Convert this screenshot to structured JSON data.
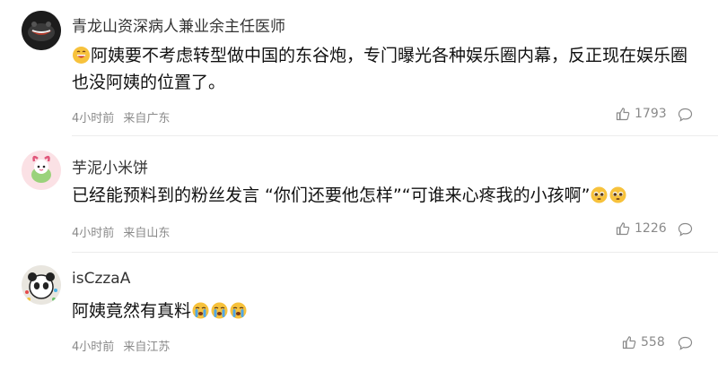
{
  "comments": [
    {
      "username": "青龙山资深病人兼业余主任医师",
      "text_prefix_emoji": "grinning-face-emoji",
      "text": "阿姨要不考虑转型做中国的东谷炮，专门曝光各种娱乐圈内幕，反正现在娱乐圈也没阿姨的位置了。",
      "time": "4小时前",
      "location": "来自广东",
      "likes": "1793"
    },
    {
      "username": "芋泥小米饼",
      "text": "已经能预料到的粉丝发言 “你们还要他怎样”“可谁来心疼我的小孩啊”",
      "trailing_emojis": [
        "pleading-face-emoji",
        "pleading-face-emoji"
      ],
      "time": "4小时前",
      "location": "来自山东",
      "likes": "1226"
    },
    {
      "username": "isCzzaA",
      "text": "阿姨竟然有真料",
      "trailing_emojis": [
        "crying-face-emoji",
        "crying-face-emoji",
        "crying-face-emoji"
      ],
      "time": "4小时前",
      "location": "来自江苏",
      "likes": "558"
    }
  ],
  "icons": {
    "like": "thumbs-up-icon",
    "reply": "comment-bubble-icon"
  },
  "colors": {
    "meta_text": "#8a8a8a",
    "divider": "#ececec",
    "emoji_yellow": "#f7c23c"
  }
}
